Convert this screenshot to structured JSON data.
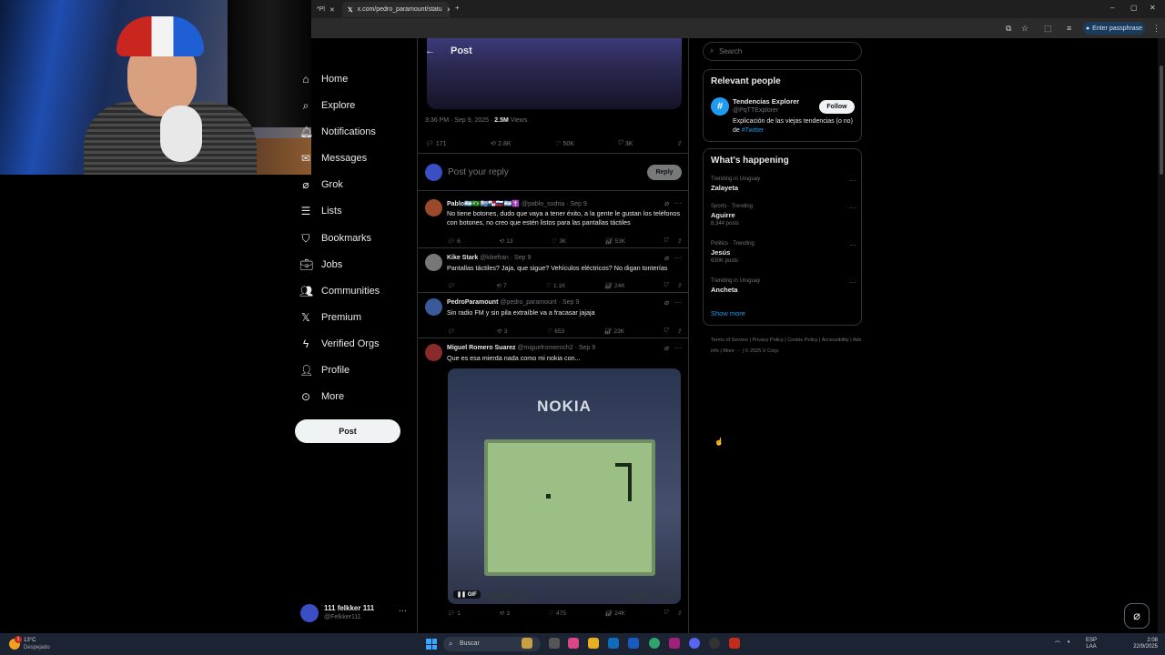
{
  "browser": {
    "tabs": [
      {
        "label": "*Pl"
      },
      {
        "label": "x.com/pedro_paramount/statu"
      }
    ],
    "new_tab": "+",
    "window_controls": {
      "minimize": "–",
      "maximize": "▢",
      "close": "✕"
    },
    "passphrase_label": "Enter passphrase"
  },
  "nav": {
    "items": [
      {
        "label": "Home",
        "icon": "home-icon"
      },
      {
        "label": "Explore",
        "icon": "search-icon"
      },
      {
        "label": "Notifications",
        "icon": "bell-icon"
      },
      {
        "label": "Messages",
        "icon": "mail-icon"
      },
      {
        "label": "Grok",
        "icon": "grok-icon"
      },
      {
        "label": "Lists",
        "icon": "list-icon"
      },
      {
        "label": "Bookmarks",
        "icon": "bookmark-icon"
      },
      {
        "label": "Jobs",
        "icon": "briefcase-icon"
      },
      {
        "label": "Communities",
        "icon": "people-icon"
      },
      {
        "label": "Premium",
        "icon": "x-logo-icon"
      },
      {
        "label": "Verified Orgs",
        "icon": "lightning-icon"
      },
      {
        "label": "Profile",
        "icon": "user-icon"
      },
      {
        "label": "More",
        "icon": "more-circle-icon"
      }
    ],
    "post_button": "Post",
    "account": {
      "name": "111 felkker 111",
      "handle": "@Felkker111",
      "more": "···"
    }
  },
  "main": {
    "header": {
      "title": "Post",
      "back": "←"
    },
    "post_meta": {
      "time": "3:36 PM · Sep 9, 2025 · ",
      "views_count": "2.5M",
      "views_label": " Views"
    },
    "post_actions": {
      "replies": "171",
      "reposts": "2.8K",
      "likes": "50K",
      "bookmarks": "3K"
    },
    "reply_box": {
      "placeholder": "Post your reply",
      "button": "Reply"
    },
    "tweets": [
      {
        "name": "Pablo🇦🇷🇧🇷🇺🇾🇵🇦🇷🇺🇦🇷✝️",
        "handle": "@pablo_sudria",
        "date": "· Sep 9",
        "text": "No tiene botones, dudo que vaya a tener éxito, a la gente le gustan los teléfonos con botones, no creo que estén listos para las pantallas táctiles",
        "replies": "6",
        "reposts": "13",
        "likes": "3K",
        "views": "53K"
      },
      {
        "name": "Kike Stark",
        "handle": "@kikefran",
        "date": "· Sep 9",
        "text": "Pantallas táctiles? Jaja, que sigue? Vehículos eléctricos? No digan tonterías",
        "replies": "",
        "reposts": "7",
        "likes": "1.1K",
        "views": "24K"
      },
      {
        "name": "PedroParamount",
        "handle": "@pedro_paramount",
        "date": "· Sep 9",
        "text": "Sin radio FM y sin pila extraíble va a fracasar jajaja",
        "replies": "",
        "reposts": "3",
        "likes": "653",
        "views": "23K"
      },
      {
        "name": "Miguel Romero Suarez",
        "handle": "@miguelromeroch2",
        "date": "· Sep 9",
        "text": "Que es esa mierda nada como mi nokia con...",
        "replies": "1",
        "reposts": "3",
        "likes": "475",
        "views": "24K",
        "gif": {
          "brand": "NOKIA",
          "score": "SCORE: 127",
          "level": "LEVEL: SLUG",
          "badge": "GIF"
        }
      }
    ]
  },
  "right": {
    "search_placeholder": "Search",
    "relevant": {
      "title": "Relevant people",
      "name": "Tendencias Explorer",
      "handle": "@PqTTExplorer",
      "bio_text": "Explicación de las viejas tendencias (o no) de ",
      "bio_link": "#Twitter",
      "follow": "Follow",
      "avatar_glyph": "#"
    },
    "happening": {
      "title": "What's happening",
      "trends": [
        {
          "context": "Trending in Uruguay",
          "name": "Zalayeta",
          "posts": ""
        },
        {
          "context": "Sports · Trending",
          "name": "Aguirre",
          "posts": "8,344 posts"
        },
        {
          "context": "Politics · Trending",
          "name": "Jesús",
          "posts": "630K posts"
        },
        {
          "context": "Trending in Uruguay",
          "name": "Ancheta",
          "posts": ""
        }
      ],
      "show_more": "Show more"
    },
    "footer_links": [
      "Terms of Service",
      "Privacy Policy",
      "Cookie Policy",
      "Accessibility",
      "Ads info",
      "More ···",
      "© 2025 X Corp."
    ]
  },
  "taskbar": {
    "weather_temp": "13°C",
    "weather_desc": "Despejado",
    "weather_badge": "1",
    "search": "Buscar",
    "lang": "ESP\nLAA",
    "time": "2:08",
    "date": "22/9/2025"
  },
  "colors": {
    "accent": "#1d9bf0",
    "background": "#000000",
    "text": "#e7e9ea",
    "muted": "#71767b",
    "border": "#2f3336"
  }
}
